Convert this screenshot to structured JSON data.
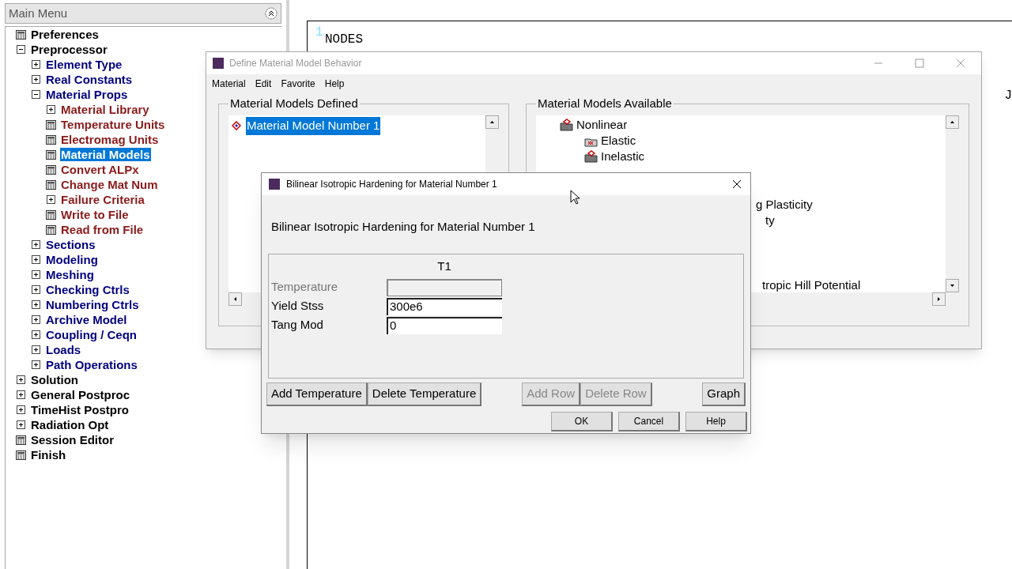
{
  "main_menu": {
    "title": "Main Menu",
    "items": [
      {
        "label": "Preferences",
        "kind": "action",
        "selected": false
      },
      {
        "label": "Preprocessor",
        "kind": "folder",
        "expanded": true,
        "selected": false,
        "children": [
          {
            "label": "Element Type",
            "kind": "folder",
            "expanded": false,
            "selected": false
          },
          {
            "label": "Real Constants",
            "kind": "folder",
            "expanded": false,
            "selected": false
          },
          {
            "label": "Material Props",
            "kind": "folder",
            "expanded": true,
            "selected": false,
            "children": [
              {
                "label": "Material Library",
                "kind": "folder",
                "expanded": false,
                "selected": false
              },
              {
                "label": "Temperature Units",
                "kind": "action",
                "selected": false
              },
              {
                "label": "Electromag Units",
                "kind": "action",
                "selected": false
              },
              {
                "label": "Material Models",
                "kind": "action",
                "selected": true
              },
              {
                "label": "Convert ALPx",
                "kind": "action",
                "selected": false
              },
              {
                "label": "Change Mat Num",
                "kind": "action",
                "selected": false
              },
              {
                "label": "Failure Criteria",
                "kind": "folder",
                "expanded": false,
                "selected": false
              },
              {
                "label": "Write to File",
                "kind": "action",
                "selected": false
              },
              {
                "label": "Read from File",
                "kind": "action",
                "selected": false
              }
            ]
          },
          {
            "label": "Sections",
            "kind": "folder",
            "expanded": false,
            "selected": false
          },
          {
            "label": "Modeling",
            "kind": "folder",
            "expanded": false,
            "selected": false
          },
          {
            "label": "Meshing",
            "kind": "folder",
            "expanded": false,
            "selected": false
          },
          {
            "label": "Checking Ctrls",
            "kind": "folder",
            "expanded": false,
            "selected": false
          },
          {
            "label": "Numbering Ctrls",
            "kind": "folder",
            "expanded": false,
            "selected": false
          },
          {
            "label": "Archive Model",
            "kind": "folder",
            "expanded": false,
            "selected": false
          },
          {
            "label": "Coupling / Ceqn",
            "kind": "folder",
            "expanded": false,
            "selected": false
          },
          {
            "label": "Loads",
            "kind": "folder",
            "expanded": false,
            "selected": false
          },
          {
            "label": "Path Operations",
            "kind": "folder",
            "expanded": false,
            "selected": false
          }
        ]
      },
      {
        "label": "Solution",
        "kind": "folder",
        "expanded": false,
        "selected": false
      },
      {
        "label": "General Postproc",
        "kind": "folder",
        "expanded": false,
        "selected": false
      },
      {
        "label": "TimeHist Postpro",
        "kind": "folder",
        "expanded": false,
        "selected": false
      },
      {
        "label": "Radiation Opt",
        "kind": "folder",
        "expanded": false,
        "selected": false
      },
      {
        "label": "Session Editor",
        "kind": "action",
        "selected": false
      },
      {
        "label": "Finish",
        "kind": "action",
        "selected": false
      }
    ]
  },
  "graphics": {
    "window_number": "1",
    "label": "NODES",
    "edge_text": "J"
  },
  "material_window": {
    "title": "Define Material Model Behavior",
    "menu": [
      "Material",
      "Edit",
      "Favorite",
      "Help"
    ],
    "defined": {
      "title": "Material Models Defined",
      "items": [
        {
          "label": "Material Model Number 1",
          "selected": true
        }
      ]
    },
    "available": {
      "title": "Material Models Available",
      "items": [
        {
          "label": "Nonlinear",
          "kind": "open",
          "children": [
            {
              "label": "Elastic",
              "kind": "closed"
            },
            {
              "label": "Inelastic",
              "kind": "open"
            }
          ]
        }
      ],
      "partial_texts": [
        "g Plasticity",
        "ty",
        "tropic Hill Potential"
      ]
    }
  },
  "dialog": {
    "title": "Bilinear Isotropic Hardening for Material Number 1",
    "heading": "Bilinear Isotropic Hardening for Material Number 1",
    "column": "T1",
    "rows": [
      {
        "label": "Temperature",
        "value": "",
        "disabled": true
      },
      {
        "label": "Yield Stss",
        "value": "300e6",
        "disabled": false
      },
      {
        "label": "Tang Mod",
        "value": "0",
        "disabled": false
      }
    ],
    "table_buttons": [
      {
        "label": "Add Temperature",
        "disabled": false
      },
      {
        "label": "Delete Temperature",
        "disabled": false
      },
      {
        "label": "Add Row",
        "disabled": true
      },
      {
        "label": "Delete Row",
        "disabled": true
      },
      {
        "label": "Graph",
        "disabled": false
      }
    ],
    "buttons": [
      "OK",
      "Cancel",
      "Help"
    ]
  }
}
